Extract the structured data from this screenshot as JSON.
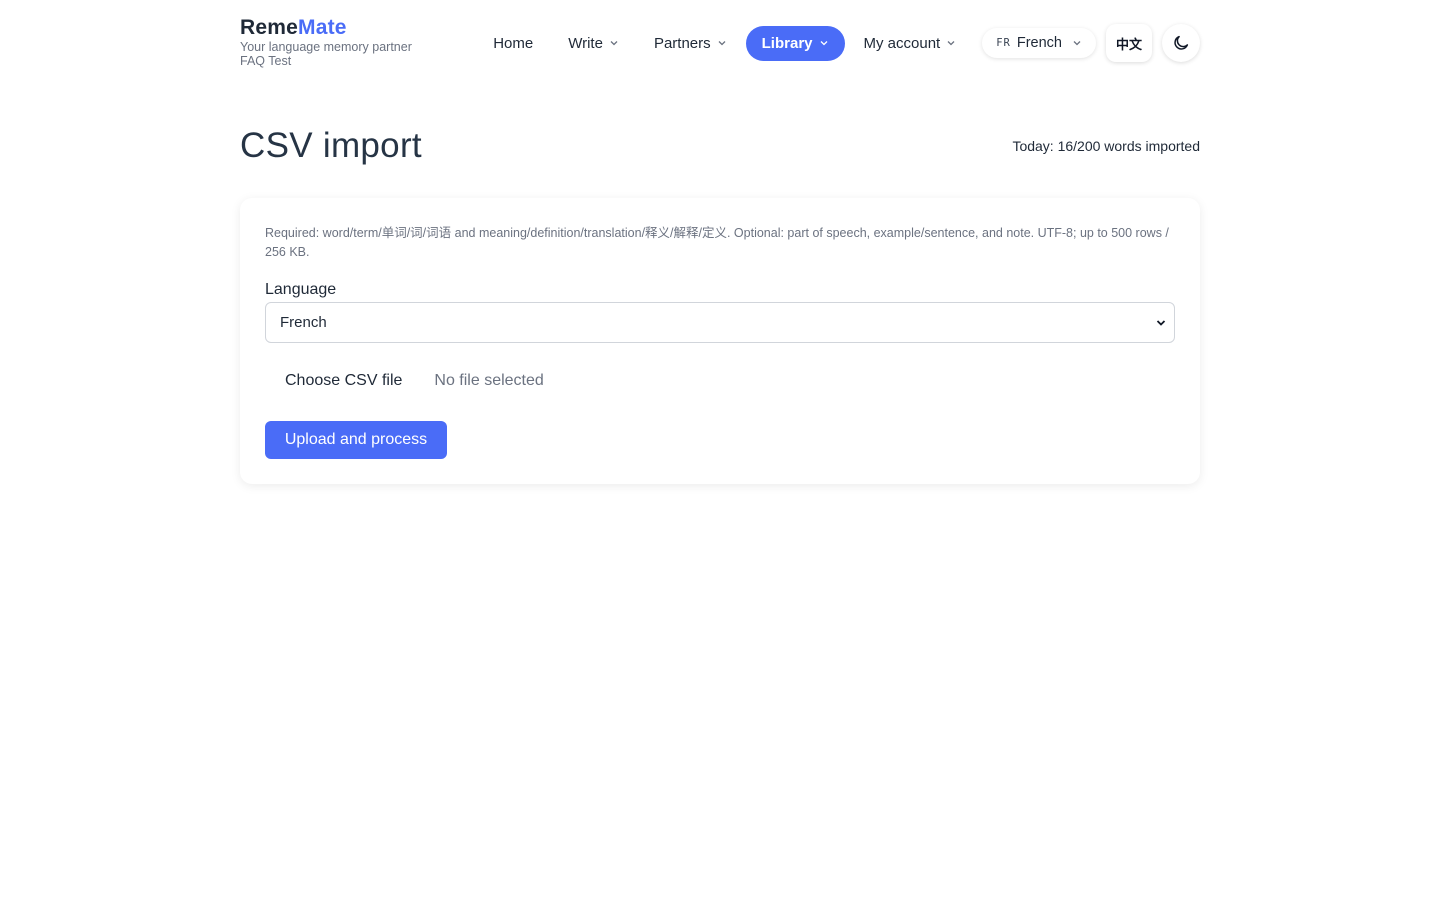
{
  "brand": {
    "name_part1": "Reme",
    "name_part2": "Mate",
    "tagline": "Your language memory partner",
    "faq_link": "FAQ Test"
  },
  "nav": {
    "home": "Home",
    "write": "Write",
    "partners": "Partners",
    "library": "Library",
    "my_account": "My account"
  },
  "language_switch": {
    "code": "FR",
    "label": "French"
  },
  "ui_lang_button": "中文",
  "theme_toggle_icon": "moon-icon",
  "page": {
    "title": "CSV import",
    "today_counter": "Today: 16/200 words imported"
  },
  "form": {
    "requirements": "Required: word/term/单词/词/词语 and meaning/definition/translation/释义/解释/定义. Optional: part of speech, example/sentence, and note. UTF-8; up to 500 rows / 256 KB.",
    "language_label": "Language",
    "language_selected": "French",
    "file_button": "Choose CSV file",
    "file_status": "No file selected",
    "submit": "Upload and process"
  },
  "colors": {
    "accent": "#4a6cf7",
    "text": "#1f2937",
    "muted": "#6b7280"
  }
}
